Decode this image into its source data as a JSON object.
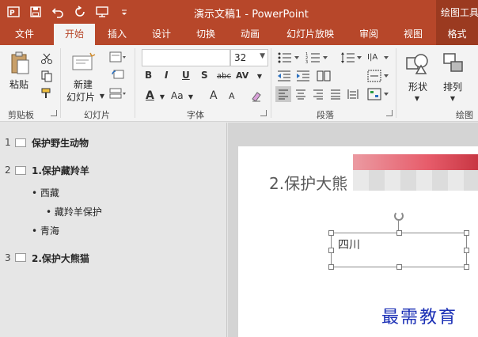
{
  "titlebar": {
    "title": "演示文稿1 - PowerPoint",
    "context_group": "绘图工具",
    "qat_icons": [
      "powerpoint-logo-icon",
      "save-icon",
      "undo-icon",
      "redo-icon",
      "start-from-beginning-icon",
      "customize-qat-icon"
    ],
    "bg_color": "#b7472a"
  },
  "tabs": [
    {
      "label": "文件"
    },
    {
      "label": "开始"
    },
    {
      "label": "插入"
    },
    {
      "label": "设计"
    },
    {
      "label": "切换"
    },
    {
      "label": "动画"
    },
    {
      "label": "幻灯片放映"
    },
    {
      "label": "审阅"
    },
    {
      "label": "视图"
    },
    {
      "label": "格式"
    }
  ],
  "ribbon": {
    "clipboard": {
      "label": "剪贴板",
      "paste": "粘贴"
    },
    "slides": {
      "label": "幻灯片",
      "new_slide_line1": "新建",
      "new_slide_line2": "幻灯片"
    },
    "font": {
      "label": "字体",
      "font_name": "",
      "font_size": "32",
      "format_buttons": [
        "B",
        "I",
        "U",
        "S",
        "abc",
        "AV",
        "A",
        "Aa",
        "A",
        "A"
      ]
    },
    "paragraph": {
      "label": "段落"
    },
    "drawing": {
      "label": "绘图",
      "shapes": "形状",
      "arrange": "排列"
    }
  },
  "outline": {
    "slides": [
      {
        "num": "1",
        "title": "保护野生动物",
        "bullets": []
      },
      {
        "num": "2",
        "title": "1.保护藏羚羊",
        "bullets": [
          {
            "text": "西藏",
            "level": 1
          },
          {
            "text": "藏羚羊保护",
            "level": 2
          },
          {
            "text": "青海",
            "level": 1
          }
        ]
      },
      {
        "num": "3",
        "title": "2.保护大熊猫",
        "bullets": []
      }
    ]
  },
  "slide": {
    "title": "2.保护大熊",
    "textbox": "四川"
  },
  "watermark": "最需教育"
}
